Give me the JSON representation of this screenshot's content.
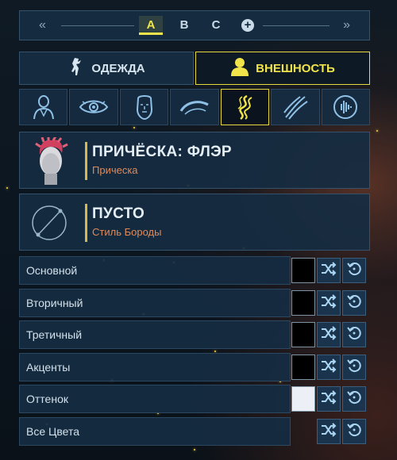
{
  "loadout": {
    "left_arrow": "«",
    "right_arrow": "»",
    "slots": [
      "A",
      "B",
      "C"
    ],
    "active_slot": "A",
    "add_slot": "+"
  },
  "tabs": [
    {
      "label": "ОДЕЖДА",
      "icon": "figure-icon",
      "active": false
    },
    {
      "label": "ВНЕШНОСТЬ",
      "icon": "person-silhouette-icon",
      "active": true
    }
  ],
  "categories": [
    {
      "icon": "body-bust-icon",
      "active": false
    },
    {
      "icon": "eye-icon",
      "active": false
    },
    {
      "icon": "face-mask-icon",
      "active": false
    },
    {
      "icon": "eyebrow-icon",
      "active": false
    },
    {
      "icon": "hair-strands-icon",
      "active": true
    },
    {
      "icon": "slashes-icon",
      "active": false
    },
    {
      "icon": "voice-wave-icon",
      "active": false
    }
  ],
  "items": [
    {
      "title": "ПРИЧЁСКА: ФЛЭР",
      "subtitle": "Прическа",
      "thumb": "hairstyle-thumbnail"
    },
    {
      "title": "ПУСТО",
      "subtitle": "Стиль Бороды",
      "thumb": "empty-slot-icon"
    }
  ],
  "colors": [
    {
      "label": "Основной",
      "swatch": "#000000"
    },
    {
      "label": "Вторичный",
      "swatch": "#000000"
    },
    {
      "label": "Третичный",
      "swatch": "#000000"
    },
    {
      "label": "Акценты",
      "swatch": "#000000"
    },
    {
      "label": "Оттенок",
      "swatch": "#eceff6"
    },
    {
      "label": "Все Цвета",
      "swatch": null
    }
  ],
  "accent": "#f0e44a",
  "subtitle_color": "#e08a5a"
}
